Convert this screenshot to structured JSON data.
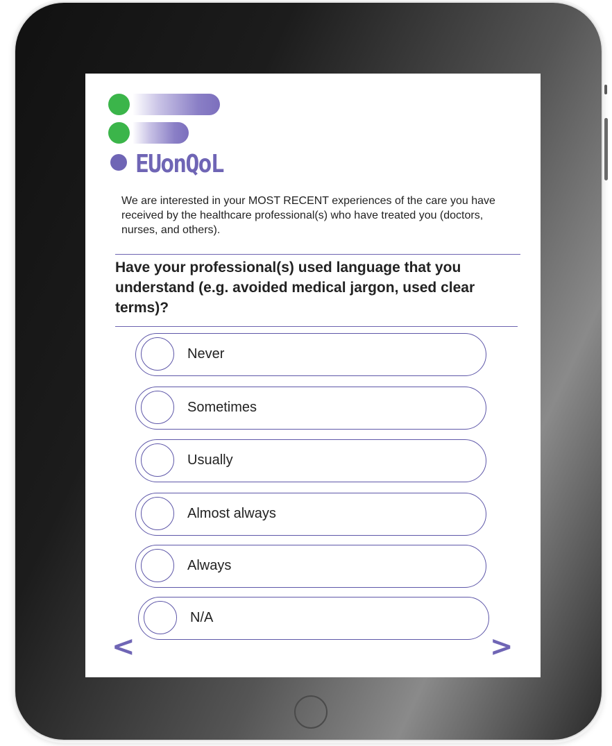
{
  "brand": {
    "name": "EUonQoL",
    "colors": {
      "green": "#3bb54a",
      "purple": "#6f65b5"
    }
  },
  "intro_text": "We are interested in your MOST RECENT experiences of the care you have received by the healthcare professional(s) who have treated you (doctors, nurses, and others).",
  "question": "Have your professional(s) used language that you understand (e.g. avoided medical jargon, used clear terms)?",
  "options": [
    {
      "label": "Never",
      "selected": false
    },
    {
      "label": "Sometimes",
      "selected": false
    },
    {
      "label": "Usually",
      "selected": false
    },
    {
      "label": "Almost always",
      "selected": false
    },
    {
      "label": "Always",
      "selected": false
    },
    {
      "label": "N/A",
      "selected": false
    }
  ],
  "nav": {
    "prev_label": "<",
    "next_label": ">"
  },
  "icons": {
    "radio": "radio-circle-icon",
    "home": "home-button-icon"
  }
}
